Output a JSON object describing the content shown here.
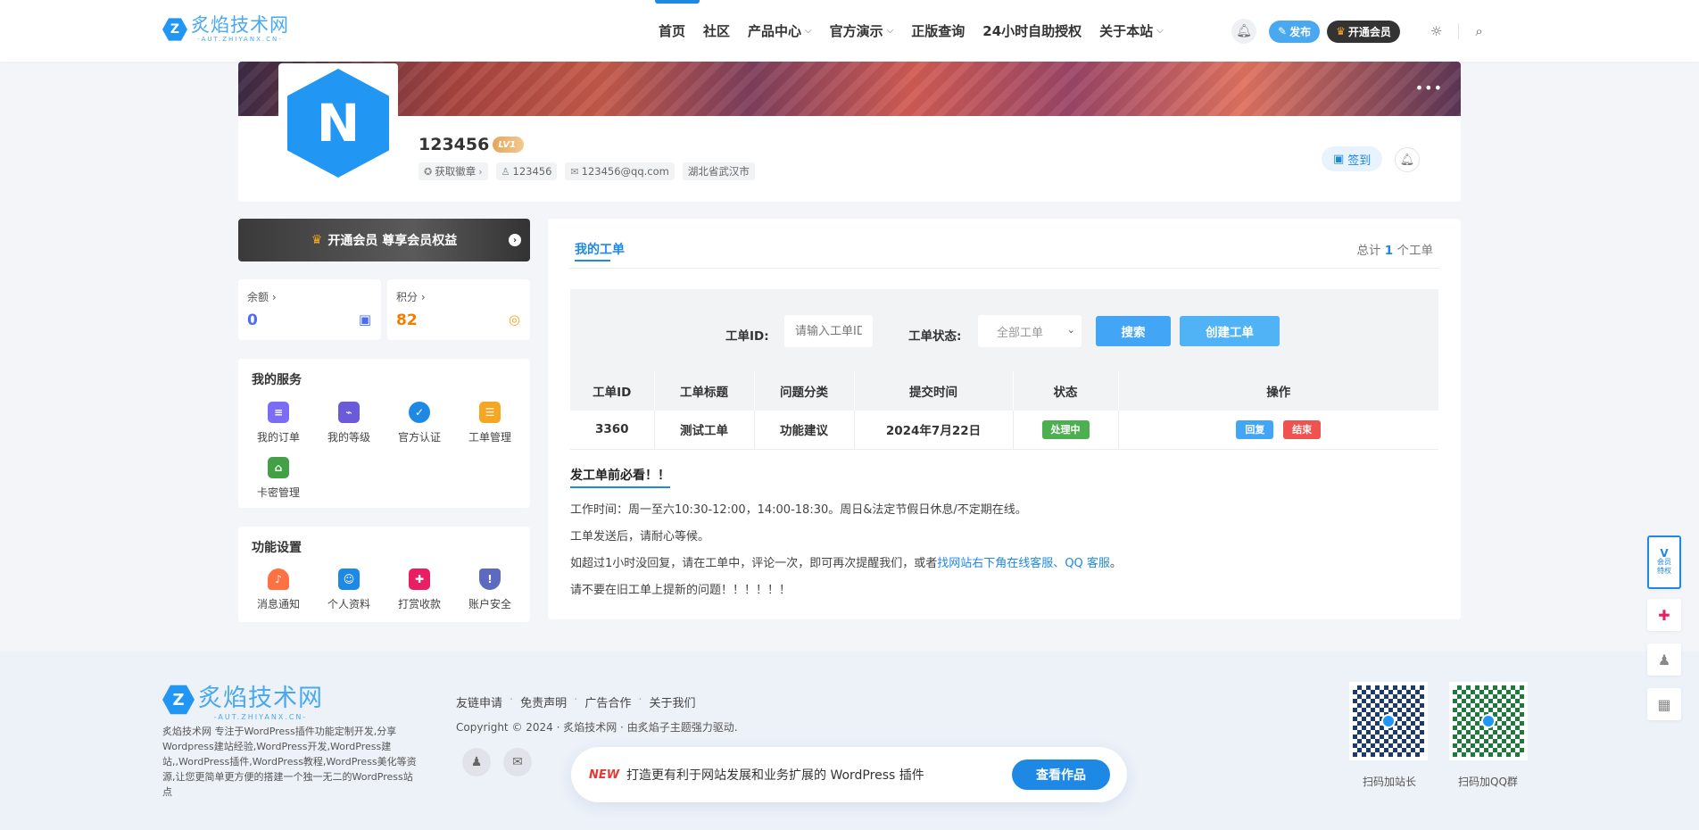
{
  "site": {
    "logo_cn": "炙焰技术网",
    "logo_en": "-AUT.ZHIYANX.CN-"
  },
  "nav": {
    "items": [
      {
        "label": "首页",
        "dropdown": false
      },
      {
        "label": "社区",
        "dropdown": false
      },
      {
        "label": "产品中心",
        "dropdown": true
      },
      {
        "label": "官方演示",
        "dropdown": true
      },
      {
        "label": "正版查询",
        "dropdown": false
      },
      {
        "label": "24小时自助授权",
        "dropdown": false
      },
      {
        "label": "关于本站",
        "dropdown": true
      }
    ],
    "publish_label": "发布",
    "vip_label": "开通会员"
  },
  "profile": {
    "username": "123456",
    "level": "LV1",
    "tags": {
      "badge": "获取徽章",
      "uid": "123456",
      "email": "123456@qq.com",
      "location": "湖北省武汉市"
    },
    "sign_label": "签到"
  },
  "sidebar": {
    "vip_banner": "开通会员 尊享会员权益",
    "balance": {
      "label": "余额",
      "value": "0"
    },
    "points": {
      "label": "积分",
      "value": "82"
    },
    "services": {
      "title": "我的服务",
      "items": [
        "我的订单",
        "我的等级",
        "官方认证",
        "工单管理",
        "卡密管理"
      ]
    },
    "settings": {
      "title": "功能设置",
      "items": [
        "消息通知",
        "个人资料",
        "打赏收款",
        "账户安全"
      ]
    }
  },
  "main": {
    "tab": "我的工单",
    "total_prefix": "总计",
    "total_count": "1",
    "total_suffix": "个工单",
    "search": {
      "id_label": "工单ID:",
      "id_placeholder": "请输入工单ID",
      "status_label": "工单状态:",
      "status_value": "全部工单",
      "search_btn": "搜索",
      "create_btn": "创建工单"
    },
    "table": {
      "headers": [
        "工单ID",
        "工单标题",
        "问题分类",
        "提交时间",
        "状态",
        "操作"
      ],
      "rows": [
        {
          "id": "3360",
          "title": "测试工单",
          "category": "功能建议",
          "time": "2024年7月22日",
          "status": "处理中",
          "reply": "回复",
          "close": "结束"
        }
      ]
    },
    "notice": {
      "title": "发工单前必看！！",
      "line1": "工作时间：周一至六10:30-12:00，14:00-18:30。周日&法定节假日休息/不定期在线。",
      "line2": "工单发送后，请耐心等候。",
      "line3_pre": "如超过1小时没回复，请在工单中，评论一次，即可再次提醒我们，或者",
      "line3_link1": "找网站右下角在线客服",
      "line3_sep": "、",
      "line3_link2": "QQ 客服",
      "line3_end": "。",
      "line4": "请不要在旧工单上提新的问题！！！！！！"
    }
  },
  "footer": {
    "desc": "炙焰技术网 专注于WordPress插件功能定制开发,分享Wordpress建站经验,WordPress开发,WordPress建站,,WordPress插件,WordPress教程,WordPress美化等资源,让您更简单更方便的搭建一个独一无二的WordPress站点",
    "links": [
      "友链申请",
      "免责声明",
      "广告合作",
      "关于我们"
    ],
    "copyright": "Copyright © 2024 · 炙焰技术网 · 由炙焰子主题强力驱动.",
    "promo_new": "NEW",
    "promo_text": "打造更有利于网站发展和业务扩展的 WordPress 插件",
    "promo_btn": "查看作品",
    "qr1_label": "扫码加站长",
    "qr2_label": "扫码加QQ群"
  },
  "float": {
    "vip_l1": "会员",
    "vip_l2": "特权"
  },
  "colors": {
    "accent": "#1e88e5",
    "processing": "#4caf50",
    "close": "#e53935",
    "reply": "#42a5f5"
  }
}
